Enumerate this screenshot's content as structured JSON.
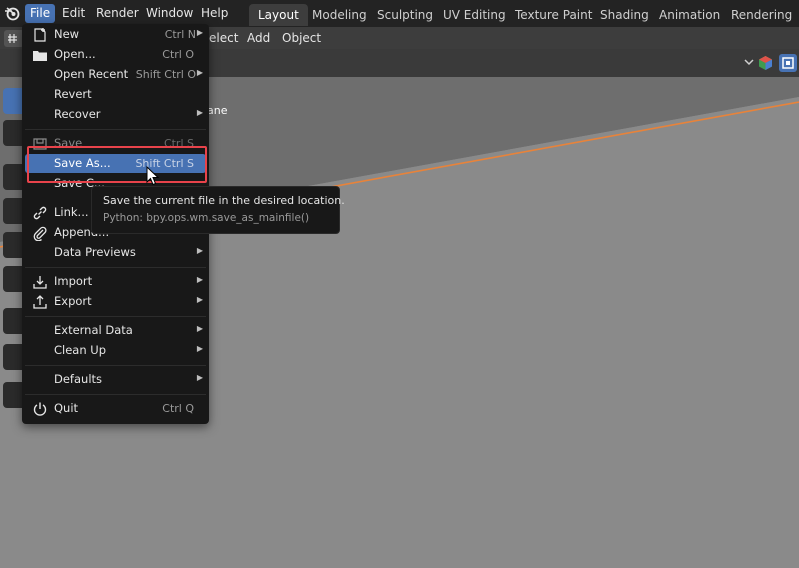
{
  "menubar": {
    "items": [
      "File",
      "Edit",
      "Render",
      "Window",
      "Help"
    ],
    "active_index": 0
  },
  "workspaces": {
    "tabs": [
      "Layout",
      "Modeling",
      "Sculpting",
      "UV Editing",
      "Texture Paint",
      "Shading",
      "Animation",
      "Rendering"
    ],
    "active_index": 0
  },
  "header": {
    "select_partial": "elect",
    "add": "Add",
    "object": "Object"
  },
  "viewport": {
    "overlay_text_partial": "ane"
  },
  "file_menu": {
    "new": {
      "label": "New",
      "shortcut": "Ctrl N"
    },
    "open": {
      "label": "Open...",
      "shortcut": "Ctrl O"
    },
    "open_recent": {
      "label": "Open Recent",
      "shortcut": "Shift Ctrl O"
    },
    "revert": {
      "label": "Revert"
    },
    "recover": {
      "label": "Recover"
    },
    "save": {
      "label": "Save",
      "shortcut": "Ctrl S"
    },
    "save_as": {
      "label": "Save As...",
      "shortcut": "Shift Ctrl S"
    },
    "save_copy": {
      "label": "Save C..."
    },
    "link": {
      "label": "Link..."
    },
    "append": {
      "label": "Append..."
    },
    "data_previews": {
      "label": "Data Previews"
    },
    "import": {
      "label": "Import"
    },
    "export": {
      "label": "Export"
    },
    "external_data": {
      "label": "External Data"
    },
    "clean_up": {
      "label": "Clean Up"
    },
    "defaults": {
      "label": "Defaults"
    },
    "quit": {
      "label": "Quit",
      "shortcut": "Ctrl Q"
    }
  },
  "tooltip": {
    "description": "Save the current file in the desired location.",
    "python": "Python: bpy.ops.wm.save_as_mainfile()"
  },
  "colors": {
    "accent": "#4772b3",
    "highlight_box": "#e8434b",
    "grid_line": "#e8833a"
  }
}
